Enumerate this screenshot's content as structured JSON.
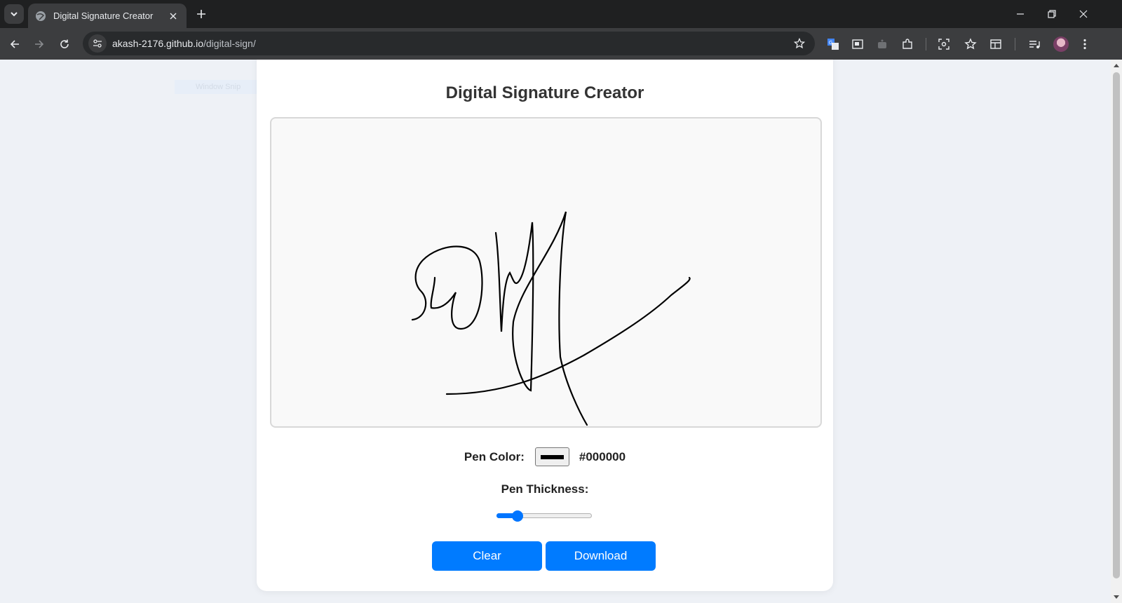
{
  "browser": {
    "tab_title": "Digital Signature Creator",
    "url_host": "akash-2176.github.io",
    "url_path": "/digital-sign/"
  },
  "page": {
    "title": "Digital Signature Creator",
    "ghost_text": "Window Snip",
    "pen_color_label": "Pen Color:",
    "pen_color_value": "#000000",
    "pen_thickness_label": "Pen Thickness:",
    "pen_thickness_level": 0.18,
    "clear_label": "Clear",
    "download_label": "Download"
  },
  "colors": {
    "button": "#007bff",
    "slider_accent": "#0075ff",
    "pen": "#000000"
  },
  "icons": [
    "tab-search-icon",
    "globe-icon",
    "close-icon",
    "plus-icon",
    "minimize-icon",
    "restore-icon",
    "back-icon",
    "forward-icon",
    "reload-icon",
    "site-info-icon",
    "star-icon",
    "translate-icon",
    "extensions-icon",
    "menu-icon"
  ]
}
